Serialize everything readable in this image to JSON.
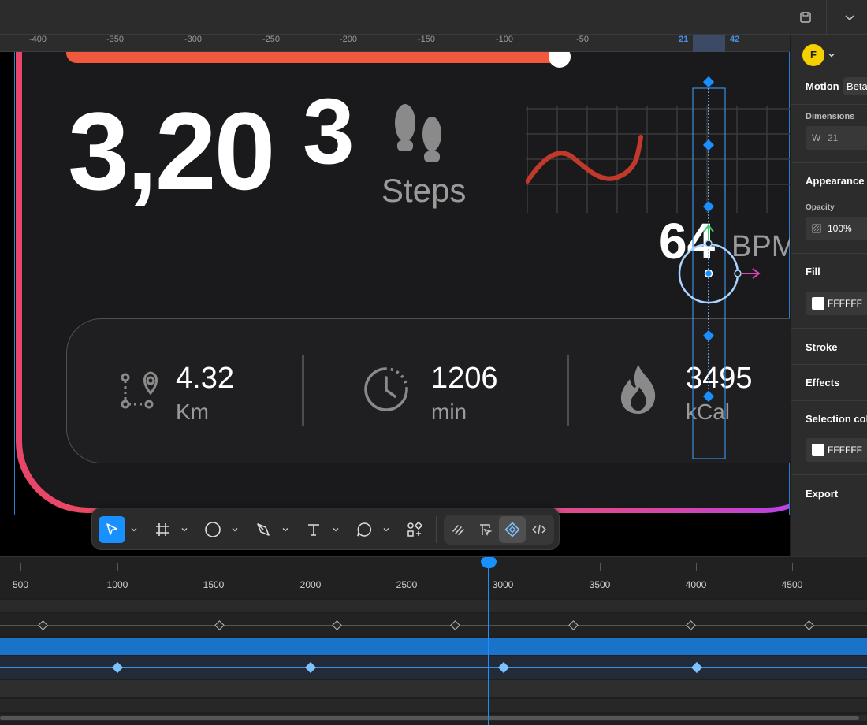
{
  "ruler": {
    "ticks": [
      "-400",
      "-350",
      "-300",
      "-250",
      "-200",
      "-150",
      "-100",
      "-50"
    ],
    "selection_start": "21",
    "selection_end": "42"
  },
  "card": {
    "steps_main": "3,20",
    "steps_sup": "3",
    "steps_label": "Steps",
    "bpm_value": "64",
    "bpm_unit": "BPM",
    "progress_fraction": 0.98,
    "stats": [
      {
        "value": "4.32",
        "unit": "Km",
        "icon": "route-pin-icon"
      },
      {
        "value": "1206",
        "unit": "min",
        "icon": "clock-icon"
      },
      {
        "value": "3495",
        "unit": "kCal",
        "icon": "flame-icon"
      }
    ]
  },
  "colors": {
    "accent": "#1890ff",
    "progress": "#f2583b",
    "gradient_start": "#e8456a",
    "gradient_end": "#b040ff",
    "heart_line": "#c1392b"
  },
  "toolbar": {
    "tools": [
      "move-tool-icon",
      "frame-tool-icon",
      "ellipse-tool-icon",
      "pen-tool-icon",
      "text-tool-icon",
      "comment-tool-icon",
      "assets-tool-icon"
    ],
    "modes": [
      "draw-mode-icon",
      "design-mode-icon",
      "prototype-mode-icon",
      "dev-mode-icon"
    ]
  },
  "panel": {
    "avatar_letter": "F",
    "tab_motion": "Motion",
    "tab_beta": "Beta",
    "dimensions_label": "Dimensions",
    "width_label": "W",
    "width_value": "21",
    "appearance": "Appearance",
    "opacity_label": "Opacity",
    "opacity_value": "100%",
    "fill": "Fill",
    "fill_value": "FFFFFF",
    "stroke": "Stroke",
    "effects": "Effects",
    "selection_colors": "Selection col",
    "selection_value": "FFFFFF",
    "export": "Export"
  },
  "timeline": {
    "labels": [
      "500",
      "1000",
      "1500",
      "2000",
      "2500",
      "3000",
      "3500",
      "4000",
      "4500"
    ]
  }
}
